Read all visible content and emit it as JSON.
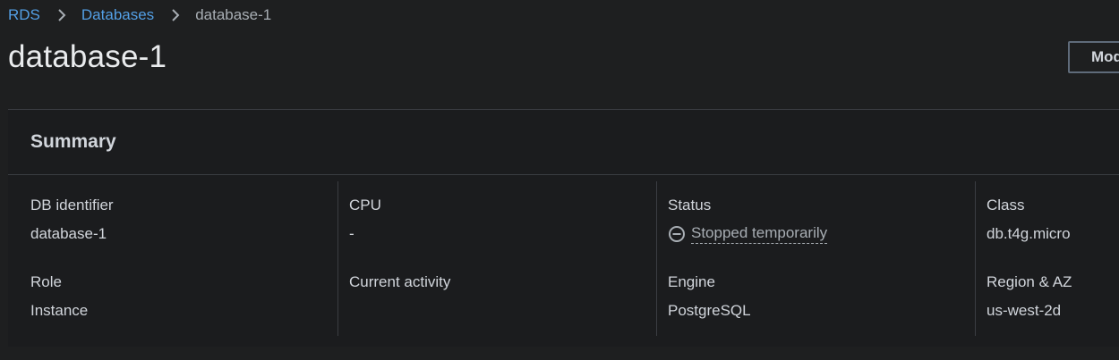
{
  "breadcrumb": {
    "root": "RDS",
    "parent": "Databases",
    "current": "database-1"
  },
  "page": {
    "title": "database-1",
    "modify_label": "Modify"
  },
  "summary": {
    "title": "Summary",
    "db_identifier_label": "DB identifier",
    "db_identifier_value": "database-1",
    "role_label": "Role",
    "role_value": "Instance",
    "cpu_label": "CPU",
    "cpu_value": "-",
    "current_activity_label": "Current activity",
    "status_label": "Status",
    "status_value": "Stopped temporarily",
    "engine_label": "Engine",
    "engine_value": "PostgreSQL",
    "class_label": "Class",
    "class_value": "db.t4g.micro",
    "region_label": "Region & AZ",
    "region_value": "us-west-2d"
  },
  "icons": {
    "separator": "chevron-right-icon",
    "status": "stopped-status-icon"
  },
  "colors": {
    "link": "#539fe5",
    "background": "#1e1f20",
    "panel": "#1b1c1e",
    "border": "#3a3d42"
  }
}
